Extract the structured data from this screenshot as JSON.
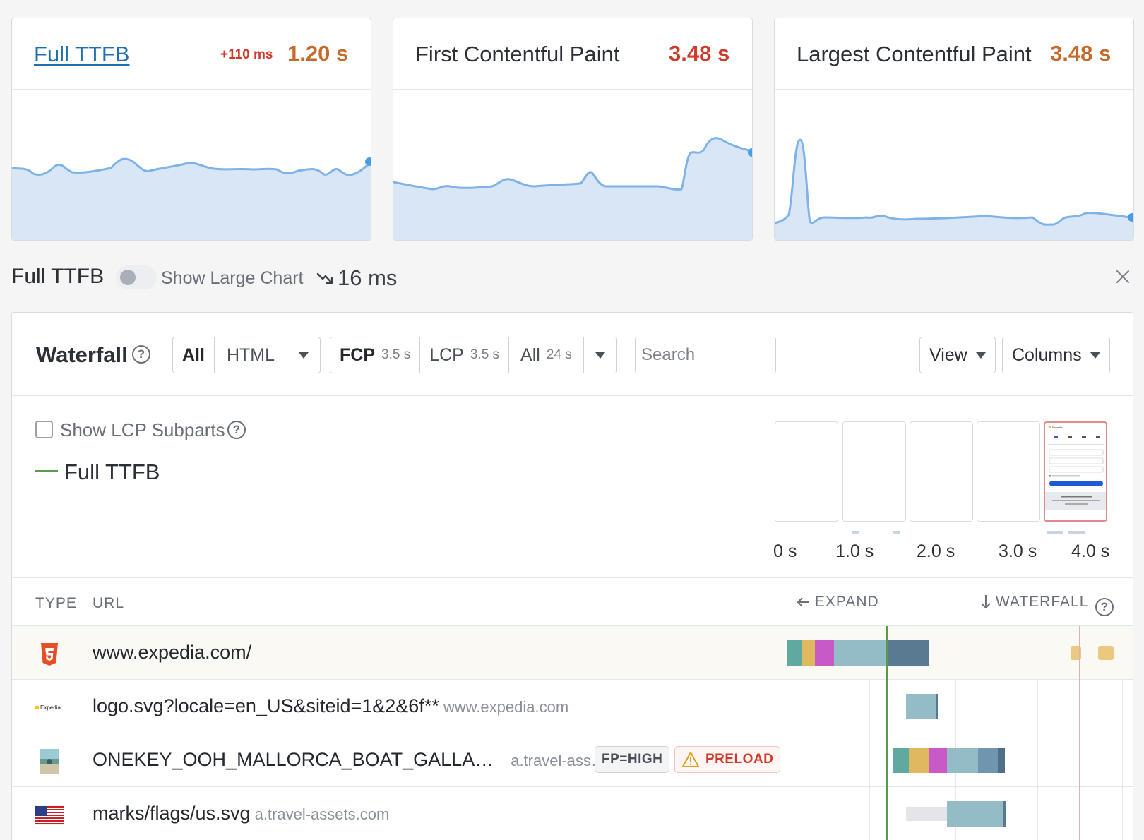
{
  "metrics": [
    {
      "title": "Full TTFB",
      "delta": "+110 ms",
      "value": "1.20 s",
      "value_color": "#c7692a",
      "link": true
    },
    {
      "title": "First Contentful Paint",
      "value": "3.48 s",
      "value_color": "#d03a2a"
    },
    {
      "title": "Largest Contentful Paint",
      "value": "3.48 s",
      "value_color": "#c7692a"
    }
  ],
  "sub_header": {
    "title": "Full TTFB",
    "toggle_label": "Show Large Chart",
    "trend_value": "16 ms",
    "trend_icon": "trend-down-icon"
  },
  "waterfall": {
    "title": "Waterfall",
    "type_filters": {
      "all": "All",
      "html": "HTML"
    },
    "milestones": [
      {
        "label": "FCP",
        "time": "3.5 s"
      },
      {
        "label": "LCP",
        "time": "3.5 s"
      },
      {
        "label": "All",
        "time": "24 s"
      }
    ],
    "search_placeholder": "Search",
    "view_label": "View",
    "columns_label": "Columns",
    "lcp_subparts_label": "Show LCP Subparts",
    "legend_label": "Full TTFB",
    "timeline_labels": [
      "0 s",
      "1.0 s",
      "2.0 s",
      "3.0 s",
      "4.0 s"
    ],
    "table_headers": {
      "type": "TYPE",
      "url": "URL",
      "expand": "EXPAND",
      "waterfall": "WATERFALL"
    },
    "rows": [
      {
        "type_icon": "html5-icon",
        "url": "www.expedia.com/",
        "host": ""
      },
      {
        "type_icon": "expedia-logo-icon",
        "url": "logo.svg?locale=en_US&siteid=1&2&6f**",
        "host": "www.expedia.com"
      },
      {
        "type_icon": "image-thumbnail-icon",
        "url": "ONEKEY_OOH_MALLORCA_BOAT_GALLA…",
        "host": "a.travel-ass…",
        "badges": {
          "fp": "FP=HIGH",
          "preload": "PRELOAD"
        }
      },
      {
        "type_icon": "us-flag-icon",
        "url": "marks/flags/us.svg",
        "host": "a.travel-assets.com"
      }
    ],
    "lcp_thumbnail_text": "Expedia"
  },
  "colors": {
    "chart_line": "#7eb3e8",
    "chart_fill": "#d9e6f6",
    "ttfb_marker": "#5a9a4a",
    "lcp_marker": "#d8b4b8"
  }
}
